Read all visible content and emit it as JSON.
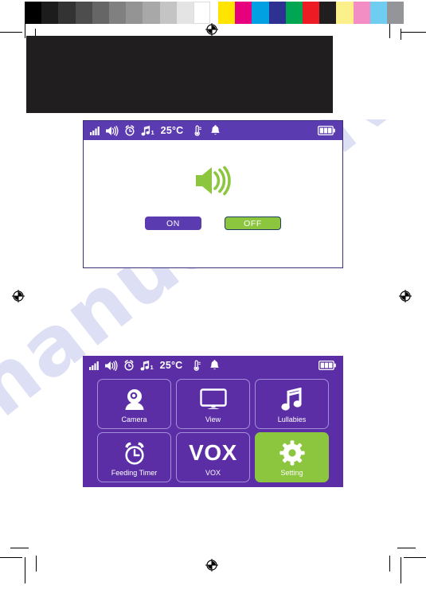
{
  "page": {
    "watermark_text": "manualshive.com",
    "accent_purple": "#5b2ea6",
    "statusbar_purple": "#5b3bb0",
    "accent_green": "#8cc63f",
    "dark_plate_color": "#211e1f"
  },
  "calibration_strip": {
    "grayscale": [
      "#000000",
      "#1c1c1c",
      "#333333",
      "#4d4d4d",
      "#666666",
      "#808080",
      "#949494",
      "#a8a8a8",
      "#c4c4c4",
      "#e4e4e4",
      "#ffffff"
    ],
    "colors": [
      "#ffe400",
      "#e6007e",
      "#00a0e3",
      "#2e3192",
      "#00a651",
      "#ed1c24",
      "#211e1f",
      "#fbf089",
      "#f38ec4",
      "#70cdf2",
      "#939598"
    ]
  },
  "status_bar": {
    "icons": [
      "signal-bars-icon",
      "speaker-icon",
      "alarm-clock-icon",
      "music-note-icon",
      "thermometer-icon",
      "bell-icon",
      "battery-icon"
    ],
    "music_note_badge": "1",
    "temperature": "25°C",
    "battery_bars": 3,
    "signal_bars": 4
  },
  "volume_screen": {
    "icon": "speaker-volume-icon",
    "buttons": [
      {
        "label": "ON",
        "state": "inactive"
      },
      {
        "label": "OFF",
        "state": "active"
      }
    ]
  },
  "menu_screen": {
    "tiles": [
      {
        "label": "Camera",
        "icon": "camera-icon",
        "selected": false
      },
      {
        "label": "View",
        "icon": "monitor-icon",
        "selected": false
      },
      {
        "label": "Lullabies",
        "icon": "music-note-icon",
        "selected": false
      },
      {
        "label": "Feeding Timer",
        "icon": "alarm-clock-icon",
        "selected": false
      },
      {
        "label": "VOX",
        "icon": "vox-text-icon",
        "selected": false,
        "big_text": "VOX"
      },
      {
        "label": "Setting",
        "icon": "gear-icon",
        "selected": true
      }
    ]
  }
}
